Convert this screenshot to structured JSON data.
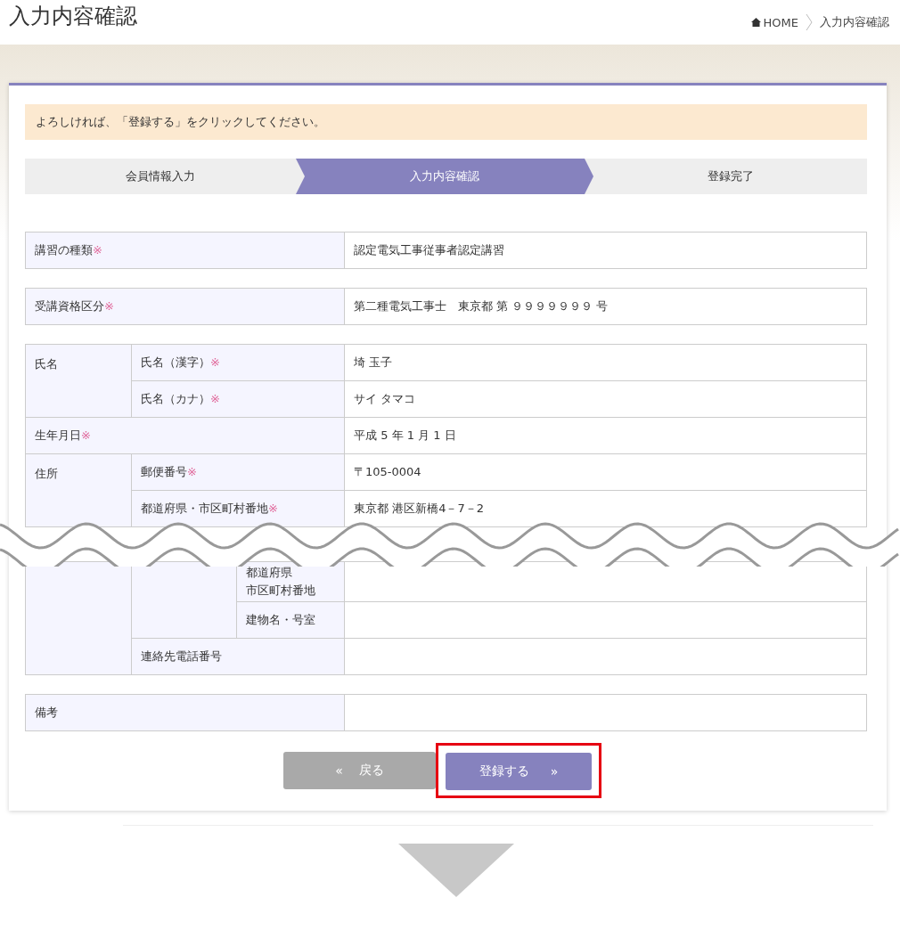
{
  "header": {
    "title": "入力内容確認",
    "breadcrumb": [
      {
        "label": "HOME",
        "kind": "home"
      },
      {
        "label": "入力内容確認",
        "kind": "current"
      }
    ]
  },
  "notice": "よろしければ、「登録する」をクリックしてください。",
  "steps": [
    {
      "label": "会員情報入力",
      "selected": false
    },
    {
      "label": "入力内容確認",
      "selected": true
    },
    {
      "label": "登録完了",
      "selected": false
    }
  ],
  "course": {
    "label": "講習の種類",
    "mark": "※",
    "value": "認定電気工事従事者認定講習"
  },
  "qualification": {
    "label": "受講資格区分",
    "mark": "※",
    "value": "第二種電気工事士　東京都 第 ９９９９９９９ 号"
  },
  "personal": {
    "name": {
      "label": "氏名",
      "fields": [
        {
          "label": "氏名（漢字）",
          "mark": "※",
          "value": "埼 玉子"
        },
        {
          "label": "氏名（カナ）",
          "mark": "※",
          "value": "サイ タマコ"
        }
      ]
    },
    "birth": {
      "label": "生年月日",
      "mark": "※",
      "value": "平成 5 年 1 月 1 日"
    },
    "address": {
      "label": "住所",
      "fields": [
        {
          "label": "郵便番号",
          "mark": "※",
          "value": "〒105-0004"
        },
        {
          "label": "都道府県・市区町村番地",
          "mark": "※",
          "value": "東京都 港区新橋4－7－2"
        }
      ],
      "sub_fields": [
        {
          "label_lines": [
            "都道府県",
            "市区町村番地"
          ]
        },
        {
          "label": "建物名・号室"
        }
      ],
      "phone": {
        "label": "連絡先電話番号"
      }
    }
  },
  "remarks": {
    "label": "備考"
  },
  "buttons": {
    "back": {
      "icon": "«",
      "label": "戻る"
    },
    "submit": {
      "label": "登録する",
      "icon": "»",
      "highlighted": true
    }
  }
}
